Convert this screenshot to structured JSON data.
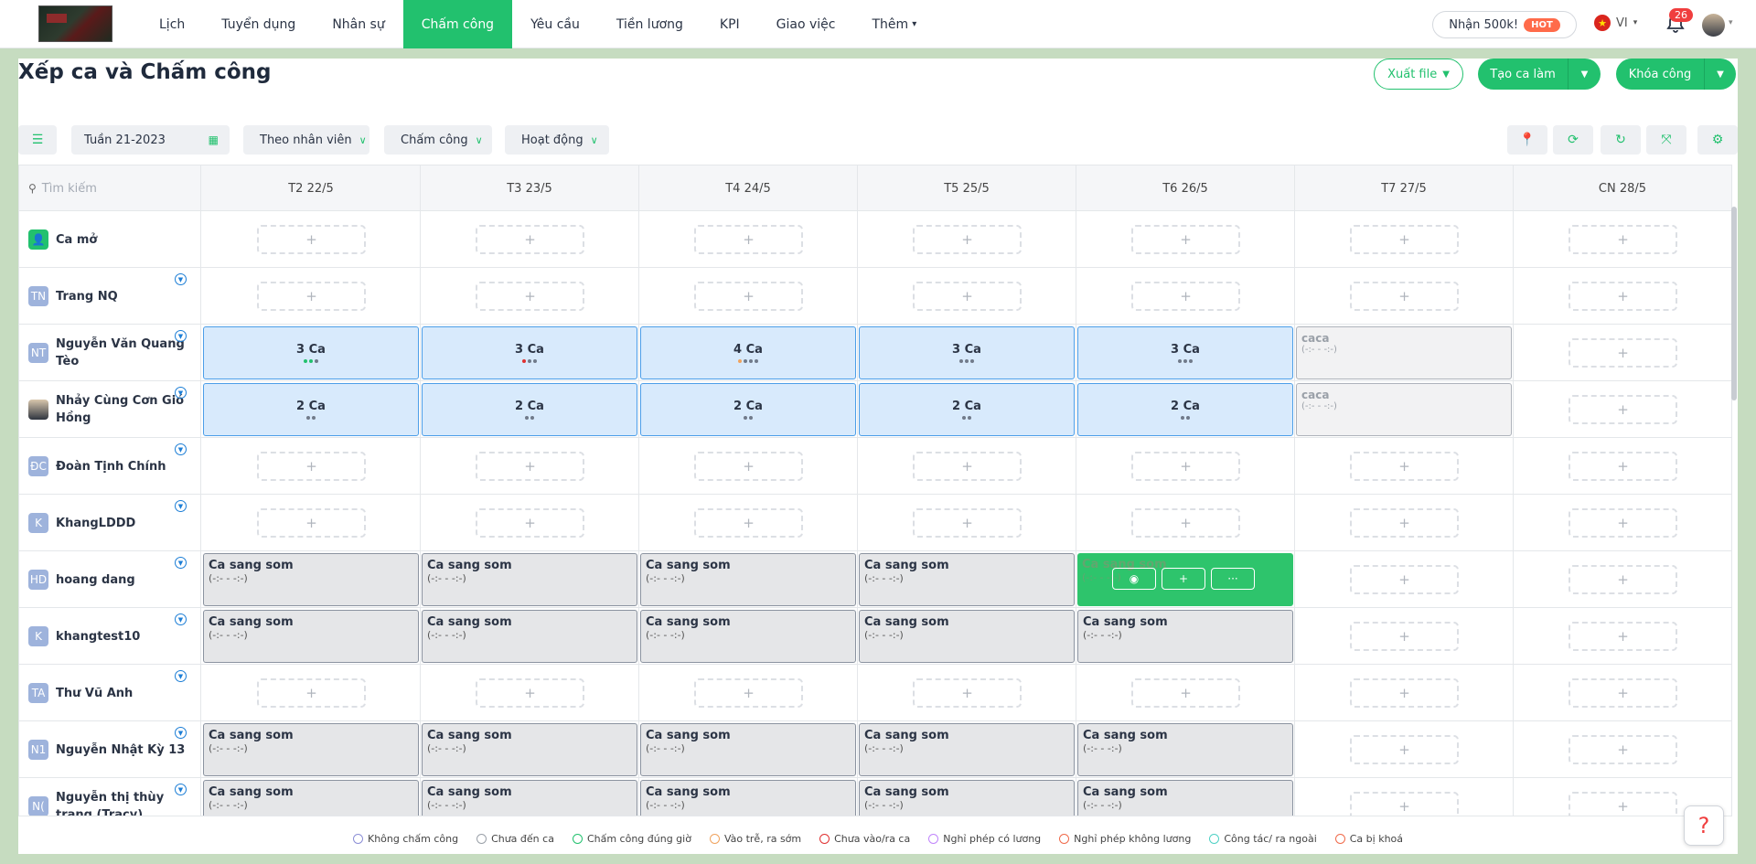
{
  "nav": {
    "items": [
      {
        "label": "Lịch"
      },
      {
        "label": "Tuyển dụng"
      },
      {
        "label": "Nhân sự"
      },
      {
        "label": "Chấm công"
      },
      {
        "label": "Yêu cầu"
      },
      {
        "label": "Tiền lương"
      },
      {
        "label": "KPI"
      },
      {
        "label": "Giao việc"
      },
      {
        "label": "Thêm"
      }
    ],
    "active_index": 3,
    "promo_label": "Nhận 500k!",
    "hot_label": "HOT",
    "lang": "VI",
    "notif_count": "26"
  },
  "page": {
    "title": "Xếp ca và Chấm công",
    "export_label": "Xuất file",
    "create_shift_label": "Tạo ca làm",
    "lock_label": "Khóa công"
  },
  "filters": {
    "week": "Tuần 21-2023",
    "by": "Theo nhân viên",
    "mode": "Chấm công",
    "status": "Hoạt động"
  },
  "grid": {
    "search_placeholder": "Tìm kiếm",
    "days": [
      "T2 22/5",
      "T3 23/5",
      "T4 24/5",
      "T5 25/5",
      "T6 26/5",
      "T7 27/5",
      "CN 28/5"
    ],
    "shift_name": "Ca sang som",
    "shift_time": "(-:- - -:-)",
    "light_shift_name": "caca",
    "rows": [
      {
        "initials": "",
        "name": "Ca mở",
        "av": "green",
        "chev": false,
        "cells": [
          "add",
          "add",
          "add",
          "add",
          "add",
          "add",
          "add"
        ]
      },
      {
        "initials": "TN",
        "name": "Trang NQ",
        "av": "blue",
        "chev": true,
        "cells": [
          "add",
          "add",
          "add",
          "add",
          "add",
          "add",
          "add"
        ]
      },
      {
        "initials": "NT",
        "name": "Nguyễn Văn Quang Tèo",
        "av": "blue",
        "chev": true,
        "cells": [
          {
            "count": "3 Ca",
            "dots": [
              "g",
              "g",
              "n"
            ]
          },
          {
            "count": "3 Ca",
            "dots": [
              "r",
              "n",
              "n"
            ]
          },
          {
            "count": "4 Ca",
            "dots": [
              "o",
              "n",
              "n",
              "n"
            ]
          },
          {
            "count": "3 Ca",
            "dots": [
              "n",
              "n",
              "n"
            ]
          },
          {
            "count": "3 Ca",
            "dots": [
              "n",
              "n",
              "n"
            ]
          },
          "light",
          "add"
        ]
      },
      {
        "initials": "",
        "name": "Nhảy Cùng Cơn Gió Hồng",
        "av": "photo",
        "chev": true,
        "cells": [
          {
            "count": "2 Ca",
            "dots": [
              "n",
              "n"
            ]
          },
          {
            "count": "2 Ca",
            "dots": [
              "n",
              "n"
            ]
          },
          {
            "count": "2 Ca",
            "dots": [
              "n",
              "n"
            ]
          },
          {
            "count": "2 Ca",
            "dots": [
              "n",
              "n"
            ]
          },
          {
            "count": "2 Ca",
            "dots": [
              "n",
              "n"
            ]
          },
          "light",
          "add"
        ]
      },
      {
        "initials": "ĐC",
        "name": "Đoàn Tịnh Chính",
        "av": "blue",
        "chev": true,
        "cells": [
          "add",
          "add",
          "add",
          "add",
          "add",
          "add",
          "add"
        ]
      },
      {
        "initials": "K",
        "name": "KhangLDDD",
        "av": "blue",
        "chev": true,
        "cells": [
          "add",
          "add",
          "add",
          "add",
          "add",
          "add",
          "add"
        ]
      },
      {
        "initials": "HD",
        "name": "hoang dang",
        "av": "blue",
        "chev": true,
        "cells": [
          "gray",
          "gray",
          "gray",
          "gray",
          "hover",
          "add",
          "add"
        ]
      },
      {
        "initials": "K",
        "name": "khangtest10",
        "av": "blue",
        "chev": true,
        "cells": [
          "gray",
          "gray",
          "gray",
          "gray",
          "gray",
          "add",
          "add"
        ]
      },
      {
        "initials": "TA",
        "name": "Thư Vũ Anh",
        "av": "blue",
        "chev": true,
        "cells": [
          "add",
          "add",
          "add",
          "add",
          "add",
          "add",
          "add"
        ]
      },
      {
        "initials": "N1",
        "name": "Nguyễn Nhật Kỳ 13",
        "av": "blue",
        "chev": true,
        "cells": [
          "gray",
          "gray",
          "gray",
          "gray",
          "gray",
          "add",
          "add"
        ]
      },
      {
        "initials": "N(",
        "name": "Nguyễn thị thùy trang (Tracy)",
        "av": "blue",
        "chev": true,
        "cells": [
          "gray",
          "gray",
          "gray",
          "gray",
          "gray",
          "add",
          "add"
        ]
      }
    ]
  },
  "legend": [
    {
      "label": "Không chấm công",
      "color": "#8c8fd6"
    },
    {
      "label": "Chưa đến ca",
      "color": "#9aa0a8"
    },
    {
      "label": "Chấm công đúng giờ",
      "color": "#22c16e"
    },
    {
      "label": "Vào trễ, ra sớm",
      "color": "#f0a35e"
    },
    {
      "label": "Chưa vào/ra ca",
      "color": "#e03131"
    },
    {
      "label": "Nghỉ phép có lương",
      "color": "#c084fc"
    },
    {
      "label": "Nghỉ phép không lương",
      "color": "#f06a4a"
    },
    {
      "label": "Công tác/ ra ngoài",
      "color": "#4fd1c5"
    },
    {
      "label": "Ca bị khoá",
      "color": "#f06a4a"
    }
  ],
  "help_label": "?"
}
